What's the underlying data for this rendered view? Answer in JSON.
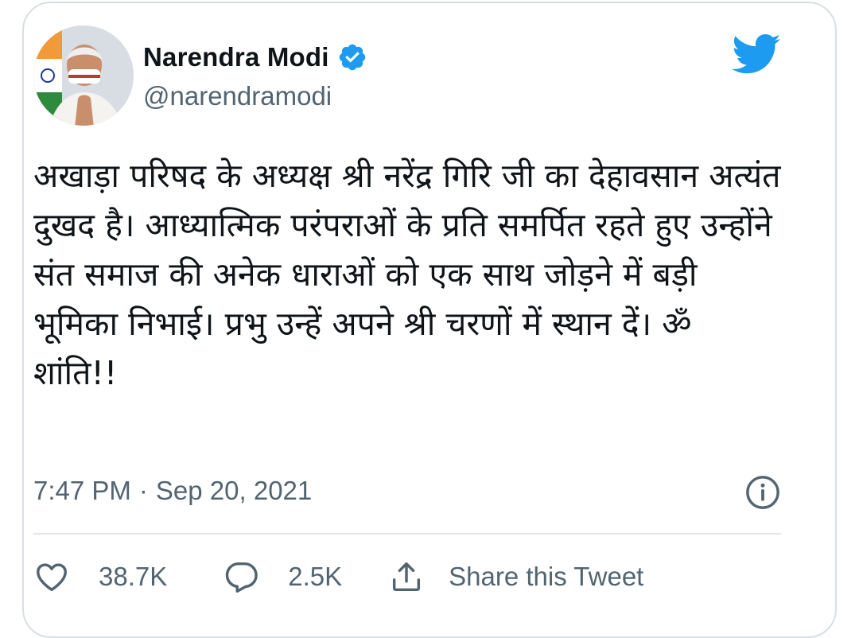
{
  "tweet": {
    "author": {
      "name": "Narendra Modi",
      "handle": "@narendramodi",
      "verified": true,
      "avatar": "profile-photo"
    },
    "brand_icon": "twitter-bird-icon",
    "text": "अखाड़ा परिषद के अध्यक्ष श्री नरेंद्र गिरि जी का देहावसान अत्यंत दुखद है। आध्यात्मिक परंपराओं के प्रति समर्पित रहते हुए उन्होंने संत समाज की अनेक धाराओं को एक साथ जोड़ने में बड़ी भूमिका निभाई। प्रभु उन्हें अपने श्री चरणों में स्थान दें। ॐ शांति!!",
    "time": "7:47 PM",
    "separator": "·",
    "date": "Sep 20, 2021",
    "actions": {
      "like": {
        "icon": "heart-icon",
        "count": "38.7K"
      },
      "reply": {
        "icon": "speech-bubble-icon",
        "count": "2.5K"
      },
      "share": {
        "icon": "share-icon",
        "label": "Share this Tweet"
      }
    },
    "info_icon": "info-icon"
  },
  "colors": {
    "twitter_blue": "#1d9bf0",
    "text_primary": "#0f1419",
    "text_secondary": "#536471",
    "border": "#d9dee3"
  }
}
